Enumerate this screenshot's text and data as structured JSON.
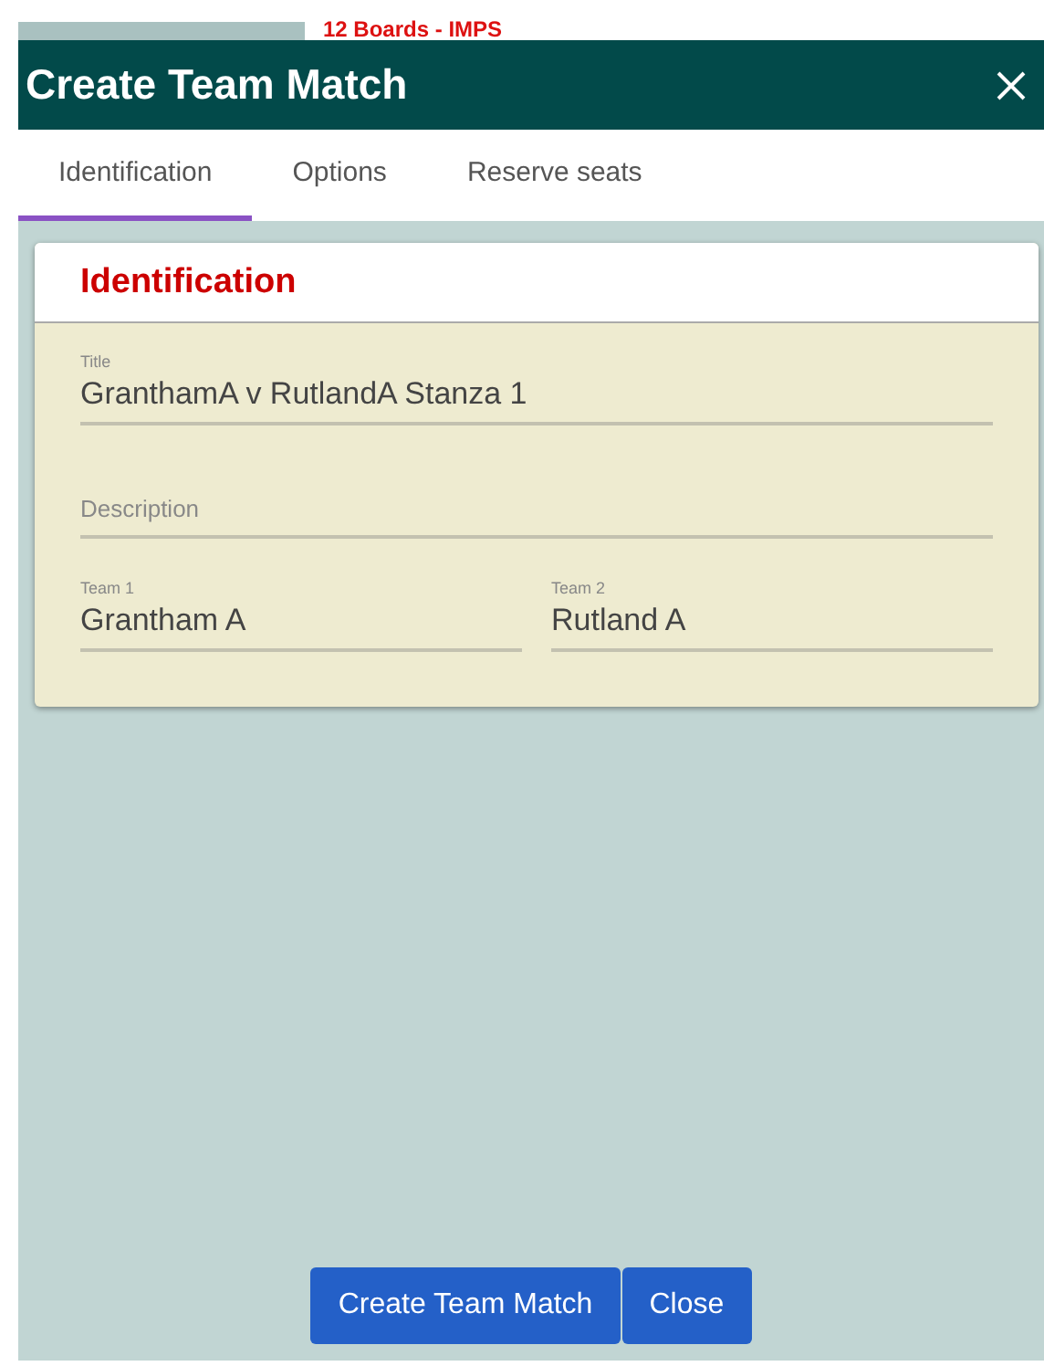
{
  "background": {
    "heading": "12 Boards - IMPS"
  },
  "dialog": {
    "title": "Create Team Match",
    "tabs": [
      {
        "label": "Identification",
        "selected": true
      },
      {
        "label": "Options",
        "selected": false
      },
      {
        "label": "Reserve seats",
        "selected": false
      }
    ],
    "section": {
      "heading": "Identification",
      "fields": [
        {
          "kind": "full",
          "label": "Title",
          "value": "GranthamA v RutlandA Stanza 1"
        },
        {
          "kind": "full",
          "placeholder": "Description"
        },
        {
          "kind": "half",
          "label": "Team 1",
          "value": "Grantham A"
        },
        {
          "kind": "half",
          "label": "Team 2",
          "value": "Rutland A"
        }
      ]
    },
    "buttons": [
      {
        "label": "Create Team Match"
      },
      {
        "label": "Close"
      }
    ]
  }
}
